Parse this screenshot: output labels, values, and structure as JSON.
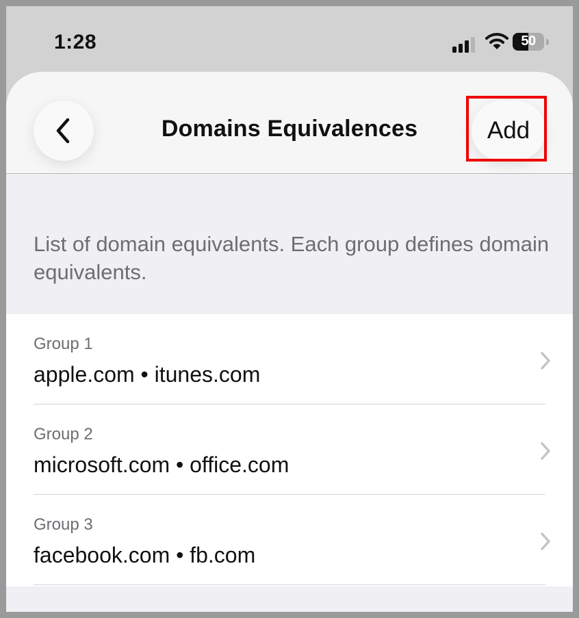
{
  "status_bar": {
    "time": "1:28",
    "battery_level": "50",
    "battery_fraction": 0.5,
    "signal_bars_active": 3,
    "icons": [
      "signal-icon",
      "wifi-icon",
      "battery-icon"
    ]
  },
  "navbar": {
    "back_icon": "chevron-left-icon",
    "title": "Domains Equivalences",
    "add_label": "Add"
  },
  "description": "List of domain equivalents. Each group defines domain equivalents.",
  "groups": [
    {
      "caption": "Group 1",
      "domains": "apple.com • itunes.com"
    },
    {
      "caption": "Group 2",
      "domains": "microsoft.com • office.com"
    },
    {
      "caption": "Group 3",
      "domains": "facebook.com • fb.com"
    }
  ],
  "colors": {
    "highlight": "#ee0000",
    "secondary_text": "#6d6d72",
    "primary_text": "#111111",
    "chevron": "#c4c4c7"
  }
}
